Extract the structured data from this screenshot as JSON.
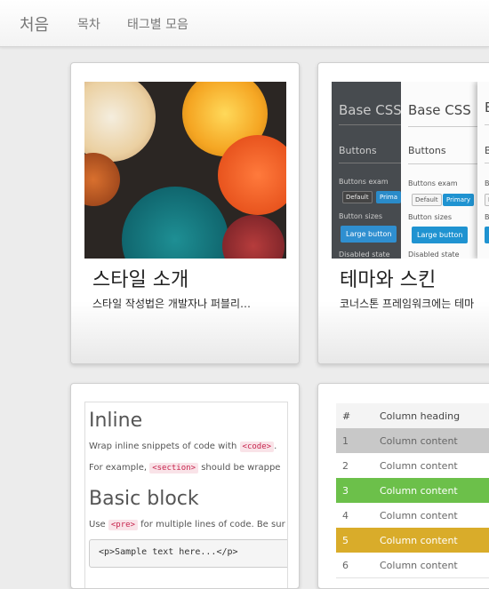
{
  "nav": {
    "brand": "처음",
    "links": [
      "목차",
      "태그별 모음"
    ]
  },
  "cards": [
    {
      "title": "스타일 소개",
      "desc": "스타일 작성법은 개발자나 퍼블리…",
      "thumb": "bokeh-photo"
    },
    {
      "title": "테마와 스킨",
      "desc": "코너스톤 프레임워크에는 테마",
      "thumb": {
        "heading": "Base CSS",
        "sub_buttons": "Buttons",
        "buttons_example": "Buttons exam",
        "btn_default": "Default",
        "btn_primary": "Primary",
        "btn_primary_cut": "Prima",
        "button_sizes": "Button sizes",
        "btn_large": "Large button",
        "disabled_state": "Disabled state"
      }
    },
    {
      "thumb": {
        "inline_heading": "Inline",
        "inline_text1_a": "Wrap inline snippets of code with",
        "inline_code1": "<code>",
        "inline_text1_b": ".",
        "inline_text2_a": "For example,",
        "inline_code2": "<section>",
        "inline_text2_b": "should be wrappe",
        "block_heading": "Basic block",
        "block_text_a": "Use",
        "block_code": "<pre>",
        "block_text_b": "for multiple lines of code. Be sur",
        "sample": "<p>Sample text here...</p>"
      }
    },
    {
      "thumb": {
        "col_num": "#",
        "col_heading": "Column heading",
        "rows": [
          {
            "num": "1",
            "text": "Column content",
            "bg": "#c8c8c8",
            "color": "#666666"
          },
          {
            "num": "2",
            "text": "Column content",
            "bg": "#ffffff",
            "color": "#666666"
          },
          {
            "num": "3",
            "text": "Column content",
            "bg": "#6cc04a",
            "color": "#ffffff"
          },
          {
            "num": "4",
            "text": "Column content",
            "bg": "#ffffff",
            "color": "#666666"
          },
          {
            "num": "5",
            "text": "Column content",
            "bg": "#d9ac2a",
            "color": "#ffffff"
          },
          {
            "num": "6",
            "text": "Column content",
            "bg": "#ffffff",
            "color": "#666666"
          }
        ]
      }
    }
  ]
}
